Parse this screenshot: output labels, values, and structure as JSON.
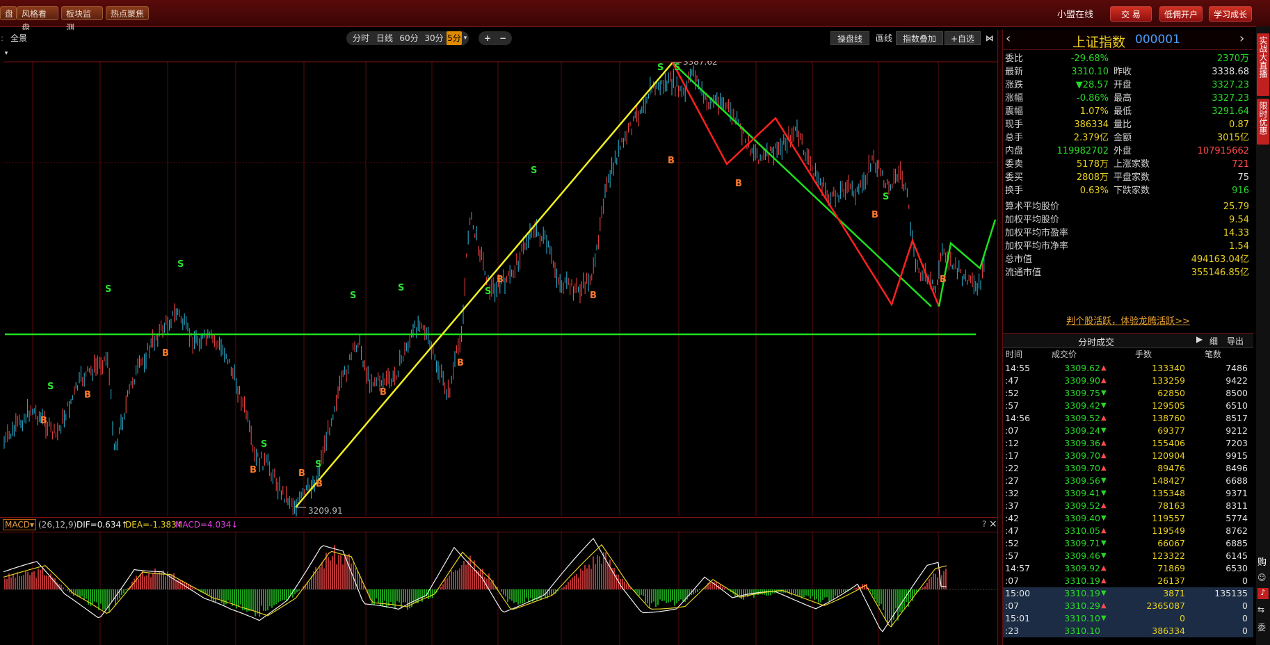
{
  "topbar": {
    "btn_0": "盘",
    "btn_1": "风格看盘",
    "btn_2": "板块监测",
    "btn_3": "热点聚焦",
    "online": "小盟在线",
    "trade": "交 易",
    "low_fee": "低佣开户",
    "learn": "学习成长"
  },
  "chartbar": {
    "full": "全景",
    "periods": [
      "分时",
      "日线",
      "60分",
      "30分",
      "5分"
    ],
    "active_period": "5分",
    "plus": "+",
    "minus": "−",
    "tools": [
      "操盘线",
      "画线",
      "指数叠加",
      "+自选"
    ]
  },
  "price_labels": {
    "high": "3387.62",
    "low": "3209.91"
  },
  "markers": {
    "buy": "B",
    "sell": "S"
  },
  "macd": {
    "name": "MACD",
    "params": "(26,12,9)",
    "dif": "DIF=0.634↑",
    "dea": "DEA=-1.383↑",
    "macd": "MACD=4.034↓",
    "help": "?",
    "close": "×"
  },
  "quote": {
    "name": "上证指数",
    "code": "000001",
    "rows": [
      {
        "l1": "委比",
        "v1": "-29.68%",
        "c1": "grn",
        "l2": "",
        "v2": "2370万",
        "c2": "grn"
      },
      {
        "l1": "最新",
        "v1": "3310.10",
        "c1": "grn",
        "l2": "昨收",
        "v2": "3338.68",
        "c2": "wht"
      },
      {
        "l1": "涨跌",
        "v1": "▼28.57",
        "c1": "grn",
        "l2": "开盘",
        "v2": "3327.23",
        "c2": "grn"
      },
      {
        "l1": "涨幅",
        "v1": "-0.86%",
        "c1": "grn",
        "l2": "最高",
        "v2": "3327.23",
        "c2": "grn"
      },
      {
        "l1": "震幅",
        "v1": "1.07%",
        "c1": "yel",
        "l2": "最低",
        "v2": "3291.64",
        "c2": "grn"
      },
      {
        "l1": "现手",
        "v1": "386334",
        "c1": "yel",
        "l2": "量比",
        "v2": "0.87",
        "c2": "yel"
      },
      {
        "l1": "总手",
        "v1": "2.379亿",
        "c1": "yel",
        "l2": "金额",
        "v2": "3015亿",
        "c2": "yel"
      },
      {
        "l1": "内盘",
        "v1": "119982702",
        "c1": "grn",
        "l2": "外盘",
        "v2": "107915662",
        "c2": "red"
      },
      {
        "l1": "委卖",
        "v1": "5178万",
        "c1": "yel",
        "l2": "上涨家数",
        "v2": "721",
        "c2": "red"
      },
      {
        "l1": "委买",
        "v1": "2808万",
        "c1": "yel",
        "l2": "平盘家数",
        "v2": "75",
        "c2": "wht"
      },
      {
        "l1": "换手",
        "v1": "0.63%",
        "c1": "yel",
        "l2": "下跌家数",
        "v2": "916",
        "c2": "grn"
      }
    ],
    "stats": [
      {
        "l": "算术平均股价",
        "v": "25.79"
      },
      {
        "l": "加权平均股价",
        "v": "9.54"
      },
      {
        "l": "加权平均市盈率",
        "v": "14.33"
      },
      {
        "l": "加权平均市净率",
        "v": "1.54"
      },
      {
        "l": "总市值",
        "v": "494163.04亿"
      },
      {
        "l": "流通市值",
        "v": "355146.85亿"
      }
    ],
    "promo": "判个股活跃，体验龙腾活跃>>"
  },
  "trades": {
    "title": "分时成交",
    "detail": "细",
    "export": "导出",
    "headers": [
      "时间",
      "成交价",
      "手数",
      "笔数"
    ],
    "rows": [
      {
        "t": "14:55",
        "p": "3309.62",
        "d": "▲",
        "q": "133340",
        "n": "7486",
        "pc": "grn",
        "dc": "red"
      },
      {
        "t": ":47",
        "p": "3309.90",
        "d": "▲",
        "q": "133259",
        "n": "9422",
        "pc": "grn",
        "dc": "red"
      },
      {
        "t": ":52",
        "p": "3309.75",
        "d": "▼",
        "q": "62850",
        "n": "8500",
        "pc": "grn",
        "dc": "grn"
      },
      {
        "t": ":57",
        "p": "3309.42",
        "d": "▼",
        "q": "129505",
        "n": "6510",
        "pc": "grn",
        "dc": "grn"
      },
      {
        "t": "14:56",
        "p": "3309.52",
        "d": "▲",
        "q": "138760",
        "n": "8517",
        "pc": "grn",
        "dc": "red"
      },
      {
        "t": ":07",
        "p": "3309.24",
        "d": "▼",
        "q": "69377",
        "n": "9212",
        "pc": "grn",
        "dc": "grn"
      },
      {
        "t": ":12",
        "p": "3309.36",
        "d": "▲",
        "q": "155406",
        "n": "7203",
        "pc": "grn",
        "dc": "red"
      },
      {
        "t": ":17",
        "p": "3309.70",
        "d": "▲",
        "q": "120904",
        "n": "9915",
        "pc": "grn",
        "dc": "red"
      },
      {
        "t": ":22",
        "p": "3309.70",
        "d": "▲",
        "q": "89476",
        "n": "8496",
        "pc": "grn",
        "dc": "red"
      },
      {
        "t": ":27",
        "p": "3309.56",
        "d": "▼",
        "q": "148427",
        "n": "6688",
        "pc": "grn",
        "dc": "grn"
      },
      {
        "t": ":32",
        "p": "3309.41",
        "d": "▼",
        "q": "135348",
        "n": "9371",
        "pc": "grn",
        "dc": "grn"
      },
      {
        "t": ":37",
        "p": "3309.52",
        "d": "▲",
        "q": "78163",
        "n": "8311",
        "pc": "grn",
        "dc": "red"
      },
      {
        "t": ":42",
        "p": "3309.40",
        "d": "▼",
        "q": "119557",
        "n": "5774",
        "pc": "grn",
        "dc": "grn"
      },
      {
        "t": ":47",
        "p": "3310.05",
        "d": "▲",
        "q": "119549",
        "n": "8762",
        "pc": "grn",
        "dc": "red"
      },
      {
        "t": ":52",
        "p": "3309.71",
        "d": "▼",
        "q": "66067",
        "n": "6885",
        "pc": "grn",
        "dc": "grn"
      },
      {
        "t": ":57",
        "p": "3309.46",
        "d": "▼",
        "q": "123322",
        "n": "6145",
        "pc": "grn",
        "dc": "grn"
      },
      {
        "t": "14:57",
        "p": "3309.92",
        "d": "▲",
        "q": "71869",
        "n": "6530",
        "pc": "grn",
        "dc": "red"
      },
      {
        "t": ":07",
        "p": "3310.19",
        "d": "▲",
        "q": "26137",
        "n": "0",
        "pc": "grn",
        "dc": "red"
      },
      {
        "t": "15:00",
        "p": "3310.19",
        "d": "▼",
        "q": "3871",
        "n": "135135",
        "pc": "grn",
        "dc": "grn",
        "hl": true
      },
      {
        "t": ":07",
        "p": "3310.29",
        "d": "▲",
        "q": "2365087",
        "n": "0",
        "pc": "grn",
        "dc": "red",
        "hl": true
      },
      {
        "t": "15:01",
        "p": "3310.10",
        "d": "▼",
        "q": "0",
        "n": "0",
        "pc": "grn",
        "dc": "grn",
        "hl": true
      },
      {
        "t": ":23",
        "p": "3310.10",
        "d": "",
        "q": "386334",
        "n": "0",
        "pc": "grn",
        "dc": "grn",
        "hl": true
      }
    ]
  },
  "strip": {
    "live": "实战大直播",
    "offer": "限时优惠",
    "buy": "购",
    "sell": "委"
  },
  "colors": {
    "up": "#ff4a4a",
    "down": "#28d828",
    "annot_green": "#1ee01e",
    "annot_yellow": "#f0f020",
    "annot_red": "#ff2020"
  }
}
